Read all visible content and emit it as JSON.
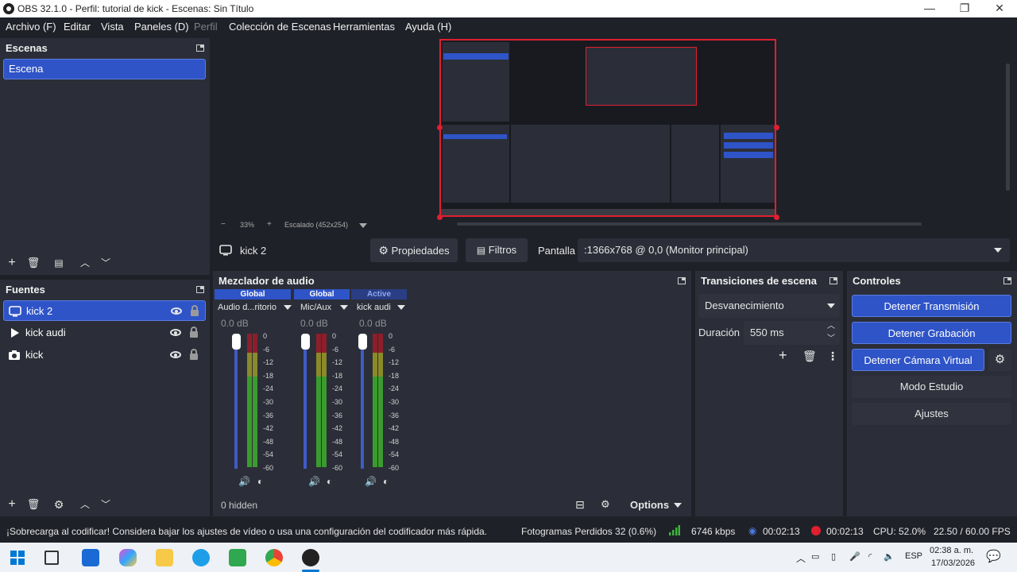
{
  "window": {
    "title": "OBS 32.1.0 - Perfil: tutorial de kick - Escenas: Sin Título",
    "minimize": "—",
    "restore": "❐",
    "close": "✕"
  },
  "menu": [
    {
      "label": "Archivo (F)",
      "enabled": true
    },
    {
      "label": "Editar",
      "enabled": true
    },
    {
      "label": "Vista",
      "enabled": true
    },
    {
      "label": "Paneles (D)",
      "enabled": true
    },
    {
      "label": "Perfil",
      "enabled": false
    },
    {
      "label": "Colección de Escenas",
      "enabled": true
    },
    {
      "label": "Herramientas",
      "enabled": true
    },
    {
      "label": "Ayuda (H)",
      "enabled": true
    }
  ],
  "scenes": {
    "title": "Escenas",
    "items": [
      "Escena"
    ]
  },
  "sources": {
    "title": "Fuentes",
    "items": [
      {
        "label": "kick 2",
        "icon": "monitor-icon",
        "selected": true
      },
      {
        "label": "kick audi",
        "icon": "play-icon",
        "selected": false
      },
      {
        "label": "kick",
        "icon": "camera-icon",
        "selected": false
      }
    ]
  },
  "preview": {
    "zoom": "33%",
    "scale": "Escalado (452x254)",
    "minus": "−",
    "plus": "+"
  },
  "source_toolbar": {
    "source_name": "kick 2",
    "properties_label": "Propiedades",
    "filters_label": "Filtros",
    "display_label": "Pantalla",
    "display_value": ":1366x768 @ 0,0 (Monitor principal)"
  },
  "mixer": {
    "title": "Mezclador de audio",
    "channels": [
      {
        "head": "Global",
        "name": "Audio d...ritorio",
        "db": "0.0 dB",
        "active": false
      },
      {
        "head": "Global",
        "name": "Mic/Aux",
        "db": "0.0 dB",
        "active": false
      },
      {
        "head": "Active",
        "name": "kick audi",
        "db": "0.0 dB",
        "active": true
      }
    ],
    "ticks": [
      "0",
      "-6",
      "-12",
      "-18",
      "-24",
      "-30",
      "-36",
      "-42",
      "-48",
      "-54",
      "-60"
    ],
    "hidden": "0 hidden",
    "options_label": "Options"
  },
  "transitions": {
    "title": "Transiciones de escena",
    "selected": "Desvanecimiento",
    "duration_label": "Duración",
    "duration_value": "550 ms"
  },
  "controls": {
    "title": "Controles",
    "buttons": [
      {
        "label": "Detener Transmisión",
        "active": true
      },
      {
        "label": "Detener Grabación",
        "active": true
      },
      {
        "label": "Detener Cámara Virtual",
        "active": true
      },
      {
        "label": "Modo Estudio",
        "active": false
      },
      {
        "label": "Ajustes",
        "active": false
      }
    ]
  },
  "status": {
    "warning": "¡Sobrecarga al codificar! Considera bajar los ajustes de vídeo o usa una configuración del codificador más rápida.",
    "dropped_frames": "Fotogramas Perdidos 32 (0.6%)",
    "bitrate": "6746 kbps",
    "stream_time": "00:02:13",
    "rec_time": "00:02:13",
    "cpu": "CPU: 52.0%",
    "fps": "22.50 / 60.00 FPS"
  },
  "taskbar": {
    "lang": "ESP",
    "time": "02:38 a. m.",
    "date": "17/03/2026"
  },
  "colors": {
    "accent": "#2f54c8",
    "recording": "#e01f2f",
    "meter_green": "#3a9c2e",
    "meter_yellow": "#8a8a2a",
    "meter_red": "#8c1f2a"
  }
}
